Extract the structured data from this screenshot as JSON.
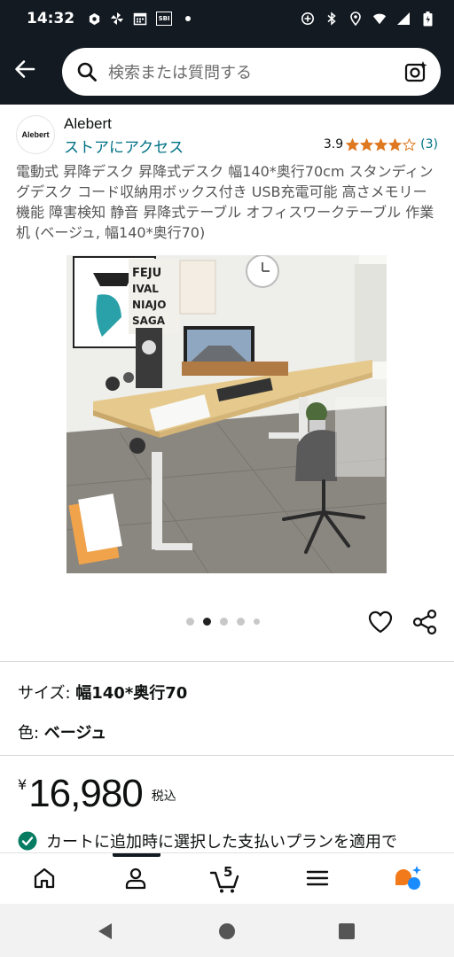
{
  "status_bar": {
    "time": "14:32",
    "sbi_label": "SBI"
  },
  "search": {
    "placeholder": "検索または質問する"
  },
  "brand": {
    "logo_text": "Alebert",
    "name": "Alebert",
    "store_link": "ストアにアクセス",
    "rating_value": "3.9",
    "rating_stars": 3.9,
    "rating_count": "(3)"
  },
  "product": {
    "title": "電動式 昇降デスク 昇降式デスク 幅140*奥行70cm スタンディングデスク コード収納用ボックス付き USB充電可能 高さメモリー機能 障害検知 静音 昇降式テーブル オフィスワークテーブル 作業机 (ベージュ, 幅140*奥行70)",
    "image_count": 5,
    "image_index": 2
  },
  "variations": {
    "size_label": "サイズ: ",
    "size_value": "幅140*奥行70",
    "color_label": "色: ",
    "color_value": "ベージュ"
  },
  "price": {
    "currency": "¥",
    "amount": "16,980",
    "tax_note": "税込"
  },
  "payment_note": "カートに追加時に選択した支払いプランを適用で",
  "bottom_nav": {
    "cart_count": "5"
  },
  "colors": {
    "header_bg": "#131a22",
    "link": "#007185",
    "star": "#de7921",
    "check": "#067d62"
  }
}
